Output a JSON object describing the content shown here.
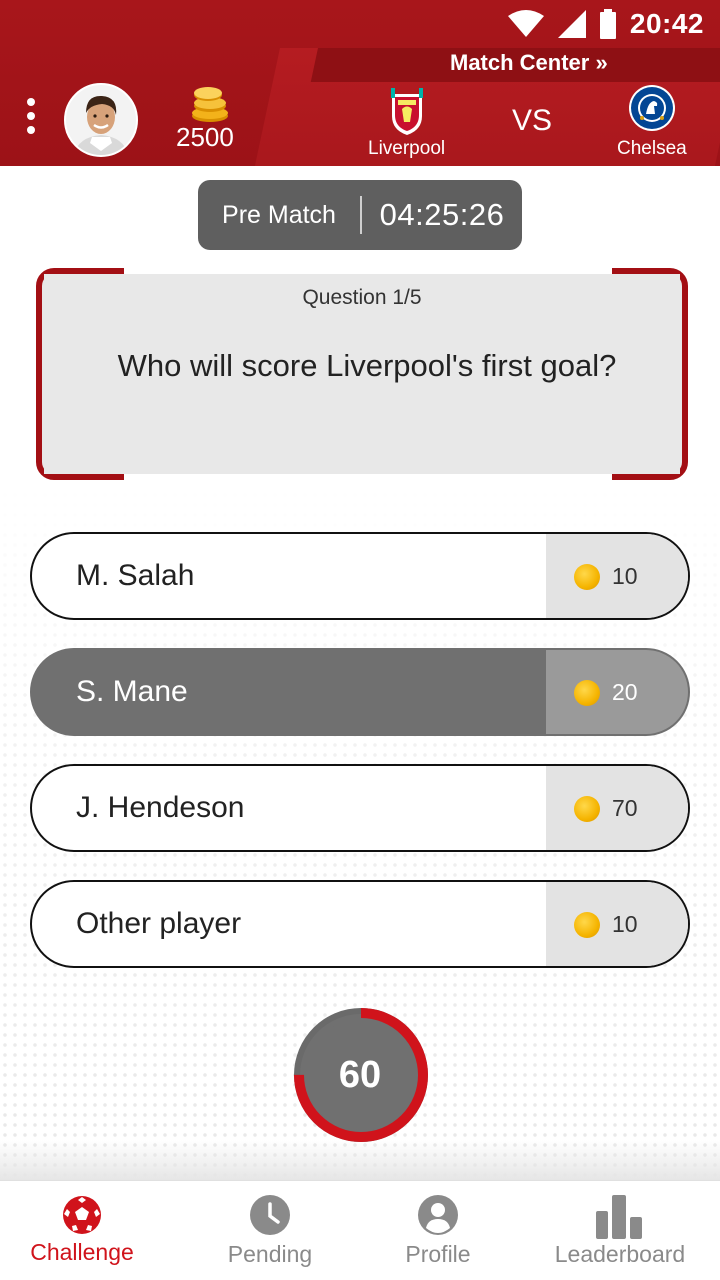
{
  "status_bar": {
    "time": "20:42"
  },
  "header": {
    "match_center_label": "Match Center »",
    "coins": "2500",
    "home_team": "Liverpool",
    "away_team": "Chelsea",
    "vs_label": "VS"
  },
  "timer": {
    "phase": "Pre Match",
    "clock": "04:25:26"
  },
  "question": {
    "number_label": "Question 1/5",
    "text": "Who will score Liverpool's first goal?"
  },
  "answers": [
    {
      "label": "M. Salah",
      "points": "10",
      "selected": false
    },
    {
      "label": "S. Mane",
      "points": "20",
      "selected": true
    },
    {
      "label": "J. Hendeson",
      "points": "70",
      "selected": false
    },
    {
      "label": "Other player",
      "points": "10",
      "selected": false
    }
  ],
  "countdown": {
    "value": "60",
    "remaining_fraction": 0.75
  },
  "nav": {
    "items": [
      {
        "label": "Challenge",
        "icon": "soccer-ball-icon",
        "active": true
      },
      {
        "label": "Pending",
        "icon": "clock-icon",
        "active": false
      },
      {
        "label": "Profile",
        "icon": "person-icon",
        "active": false
      },
      {
        "label": "Leaderboard",
        "icon": "bar-chart-icon",
        "active": false
      }
    ]
  },
  "colors": {
    "brand_red": "#a8161b",
    "accent_red": "#d0131b",
    "selected_gray": "#707070",
    "coin_gold": "#f5b400"
  }
}
